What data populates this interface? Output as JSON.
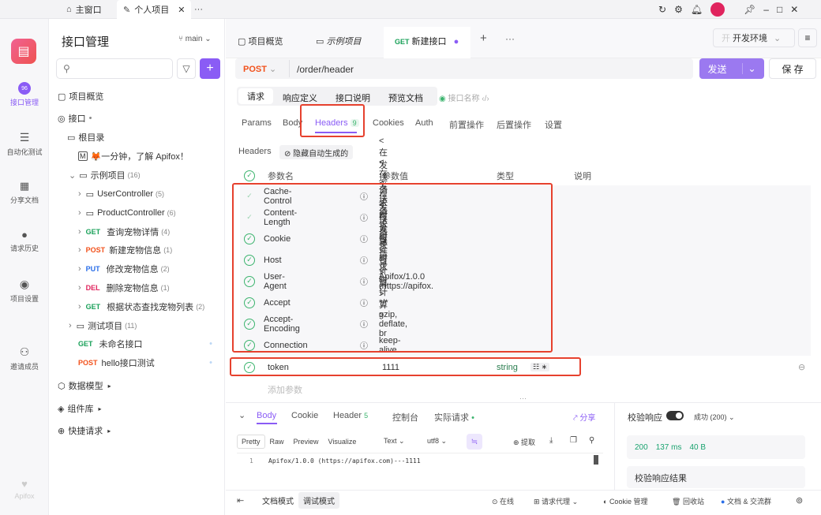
{
  "topbar": {
    "home_tab": "主窗口",
    "project_tab": "个人项目",
    "more": "···",
    "min": "–",
    "max": "□",
    "close": "✕"
  },
  "nav": {
    "items": [
      {
        "label": "接口管理",
        "icon": "api-icon"
      },
      {
        "label": "自动化测试",
        "icon": "automation-icon"
      },
      {
        "label": "分享文档",
        "icon": "share-doc-icon"
      },
      {
        "label": "请求历史",
        "icon": "history-icon"
      },
      {
        "label": "项目设置",
        "icon": "settings-icon"
      },
      {
        "label": "邀请成员",
        "icon": "invite-icon"
      }
    ],
    "brand": "Apifox"
  },
  "tree": {
    "title": "接口管理",
    "branch": "main",
    "overview": "项目概览",
    "apis": "接口",
    "root": "根目录",
    "intro": "🦊一分钟，了解 Apifox！",
    "sample": {
      "label": "示例项目",
      "count": "(16)"
    },
    "items": [
      {
        "label": "UserController",
        "count": "(5)"
      },
      {
        "label": "ProductController",
        "count": "(6)"
      },
      {
        "method": "GET",
        "label": "查询宠物详情",
        "count": "(4)"
      },
      {
        "method": "POST",
        "label": "新建宠物信息",
        "count": "(1)"
      },
      {
        "method": "PUT",
        "label": "修改宠物信息",
        "count": "(2)"
      },
      {
        "method": "DEL",
        "label": "删除宠物信息",
        "count": "(1)"
      },
      {
        "method": "GET",
        "label": "根据状态查找宠物列表",
        "count": "(2)"
      }
    ],
    "test": {
      "label": "测试项目",
      "count": "(11)"
    },
    "unnamed": {
      "method": "GET",
      "label": "未命名接口"
    },
    "hello": {
      "method": "POST",
      "label": "hello接口测试"
    },
    "models": "数据模型",
    "components": "组件库",
    "quick": "快捷请求"
  },
  "main": {
    "tabs": [
      "项目概览",
      "示例项目",
      "新建接口"
    ],
    "active_tab_method": "GET",
    "env": "开发环境",
    "method": "POST",
    "url": "/order/header",
    "send": "发送",
    "save": "保 存",
    "mode_tabs": [
      "请求",
      "响应定义",
      "接口说明",
      "预览文档"
    ],
    "api_name_placeholder": "接口名称",
    "req_tabs": [
      "Params",
      "Body",
      "Headers",
      "Cookies",
      "Auth",
      "前置操作",
      "后置操作",
      "设置"
    ],
    "headers_count": "9",
    "headers_label": "Headers",
    "hide_auto": "隐藏自动生成的",
    "cols": [
      "参数名",
      "参数值",
      "类型",
      "说明"
    ],
    "auto_headers": [
      {
        "name": "Cache-Control",
        "value": "<在发送请求时计算>"
      },
      {
        "name": "Content-Length",
        "value": "<在发送请求时计算>"
      },
      {
        "name": "Cookie",
        "value": "<在发送请求时计算>"
      },
      {
        "name": "Host",
        "value": "<在发送请求时计算>"
      },
      {
        "name": "User-Agent",
        "value": "Apifox/1.0.0 (https://apifox."
      },
      {
        "name": "Accept",
        "value": "*/*"
      },
      {
        "name": "Accept-Encoding",
        "value": "gzip, deflate, br"
      },
      {
        "name": "Connection",
        "value": "keep-alive"
      }
    ],
    "token": {
      "name": "token",
      "value": "1111",
      "type": "string"
    },
    "add_param": "添加参数"
  },
  "response": {
    "tabs": [
      "Body",
      "Cookie",
      "Header",
      "控制台",
      "实际请求"
    ],
    "header_count": "5",
    "share": "分享",
    "views": [
      "Pretty",
      "Raw",
      "Preview",
      "Visualize"
    ],
    "format": "Text",
    "encoding": "utf8",
    "extract": "提取",
    "line_no": "1",
    "body": "Apifox/1.0.0 (https://apifox.com)---1111",
    "validate": "校验响应",
    "success": "成功 (200)",
    "status": "200",
    "time": "137 ms",
    "size": "40 B",
    "validate_result": "校验响应结果"
  },
  "footer": {
    "doc_mode": "文档模式",
    "debug_mode": "调试模式",
    "online": "在线",
    "proxy": "请求代理",
    "cookie": "Cookie 管理",
    "trash": "回收站",
    "community": "文档 & 交流群"
  }
}
